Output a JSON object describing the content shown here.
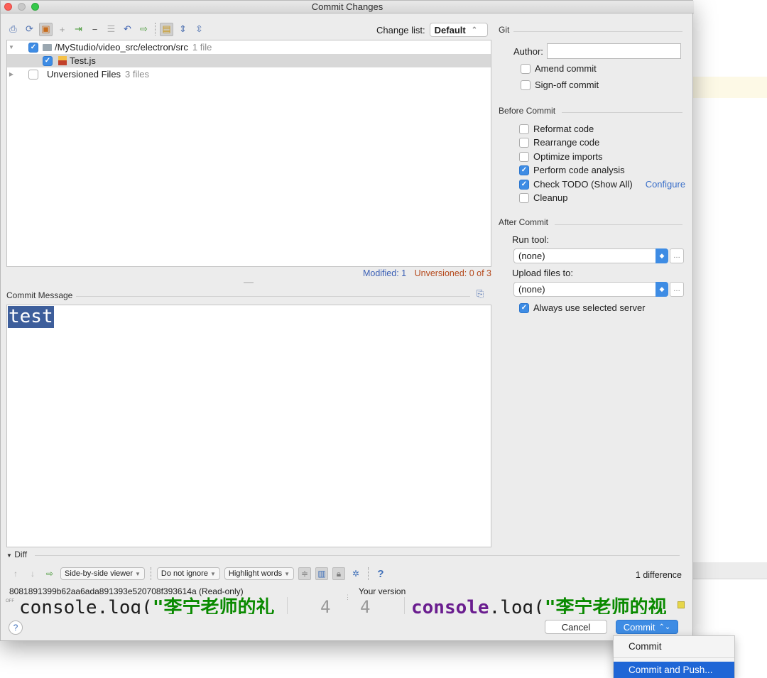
{
  "window": {
    "title": "Commit Changes"
  },
  "toolbar": {
    "icons": [
      "vcs-check-icon",
      "refresh-icon",
      "rollback-icon",
      "add-icon",
      "move-icon",
      "remove-icon",
      "group-icon",
      "undo-icon",
      "diff-icon",
      "group-by-dir-icon",
      "expand-all-icon",
      "collapse-all-icon"
    ],
    "changelist_label": "Change list:",
    "changelist_value": "Default"
  },
  "tree": {
    "rows": [
      {
        "path": "/MyStudio/video_src/electron/src",
        "count": "1 file"
      },
      {
        "name": "Test.js"
      },
      {
        "name": "Unversioned Files",
        "count": "3 files"
      }
    ]
  },
  "status": {
    "modified": "Modified: 1",
    "unversioned": "Unversioned: 0 of 3"
  },
  "commit_message": {
    "label": "Commit Message",
    "text": "test"
  },
  "git": {
    "label": "Git",
    "author_label": "Author:",
    "author_value": "",
    "amend": "Amend commit",
    "signoff": "Sign-off commit"
  },
  "before_commit": {
    "label": "Before Commit",
    "options": [
      {
        "label": "Reformat code",
        "checked": false
      },
      {
        "label": "Rearrange code",
        "checked": false
      },
      {
        "label": "Optimize imports",
        "checked": false
      },
      {
        "label": "Perform code analysis",
        "checked": true
      },
      {
        "label": "Check TODO (Show All)",
        "checked": true
      },
      {
        "label": "Cleanup",
        "checked": false
      }
    ],
    "configure_link": "Configure"
  },
  "after_commit": {
    "label": "After Commit",
    "run_tool_label": "Run tool:",
    "run_tool_value": "(none)",
    "upload_label": "Upload files to:",
    "upload_value": "(none)",
    "always_use": "Always use selected server"
  },
  "diff": {
    "label": "Diff",
    "viewer": "Side-by-side viewer",
    "ignore": "Do not ignore",
    "highlight": "Highlight words",
    "difference_count": "1 difference",
    "left_title": "8081891399b62aa6ada891393e520708f393614a (Read-only)",
    "right_title": "Your version",
    "left_code_plain": "console.log(",
    "left_code_str": "\"李宁老师的礼",
    "right_code_kw": "console",
    "right_code_plain": ".log(",
    "right_code_str": "\"李宁老师的视",
    "left_line": "4",
    "right_line": "4",
    "off_badge": "OFF"
  },
  "buttons": {
    "help": "?",
    "cancel": "Cancel",
    "commit": "Commit"
  },
  "commit_menu": {
    "items": [
      "Commit",
      "Commit and Push..."
    ]
  },
  "colors": {
    "accent": "#3e8ce4",
    "selection": "#1f66d6",
    "modified": "#3a5fb5",
    "unversioned": "#b5491c"
  }
}
